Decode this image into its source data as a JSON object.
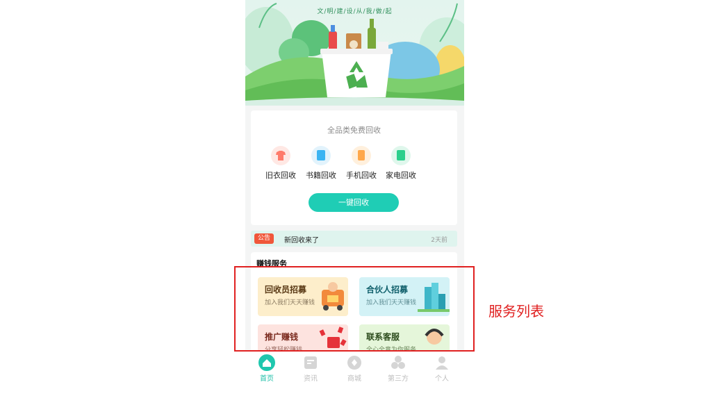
{
  "hero": {
    "slogan": "文/明/建/设/从/我/做/起"
  },
  "categories": {
    "title": "全品类免费回收",
    "items": [
      {
        "label": "旧衣回收",
        "icon": "tshirt-icon",
        "color": "#ff7b6b",
        "bg": "#ffe8e4"
      },
      {
        "label": "书籍回收",
        "icon": "book-icon",
        "color": "#3bb4f2",
        "bg": "#e2f3fc"
      },
      {
        "label": "手机回收",
        "icon": "phone-icon",
        "color": "#ffa84a",
        "bg": "#fff0dd"
      },
      {
        "label": "家电回收",
        "icon": "appliance-icon",
        "color": "#2bcf8c",
        "bg": "#dff7ec"
      }
    ],
    "button": "一键回收"
  },
  "notice": {
    "badge": "公告",
    "text": "新回收来了",
    "time": "2天前"
  },
  "services": {
    "title": "赚钱服务",
    "items": [
      {
        "name": "回收员招募",
        "sub": "加入我们天天赚钱",
        "bg": "#fdeecb"
      },
      {
        "name": "合伙人招募",
        "sub": "加入我们天天赚钱",
        "bg": "#d3f2f6"
      },
      {
        "name": "推广赚钱",
        "sub": "分享轻松赚钱",
        "bg": "#fde3df"
      },
      {
        "name": "联系客服",
        "sub": "全心全意为你服务",
        "bg": "#e5f6da"
      }
    ]
  },
  "tabbar": {
    "items": [
      {
        "label": "首页",
        "icon": "home-icon",
        "active": true
      },
      {
        "label": "资讯",
        "icon": "news-icon",
        "active": false
      },
      {
        "label": "商城",
        "icon": "mall-icon",
        "active": false
      },
      {
        "label": "第三方",
        "icon": "third-party-icon",
        "active": false
      },
      {
        "label": "个人",
        "icon": "person-icon",
        "active": false
      }
    ]
  },
  "annotation": {
    "label": "服务列表",
    "color": "#e02020"
  },
  "colors": {
    "accent": "#1fcdb5",
    "notice_badge": "#f0573a"
  }
}
